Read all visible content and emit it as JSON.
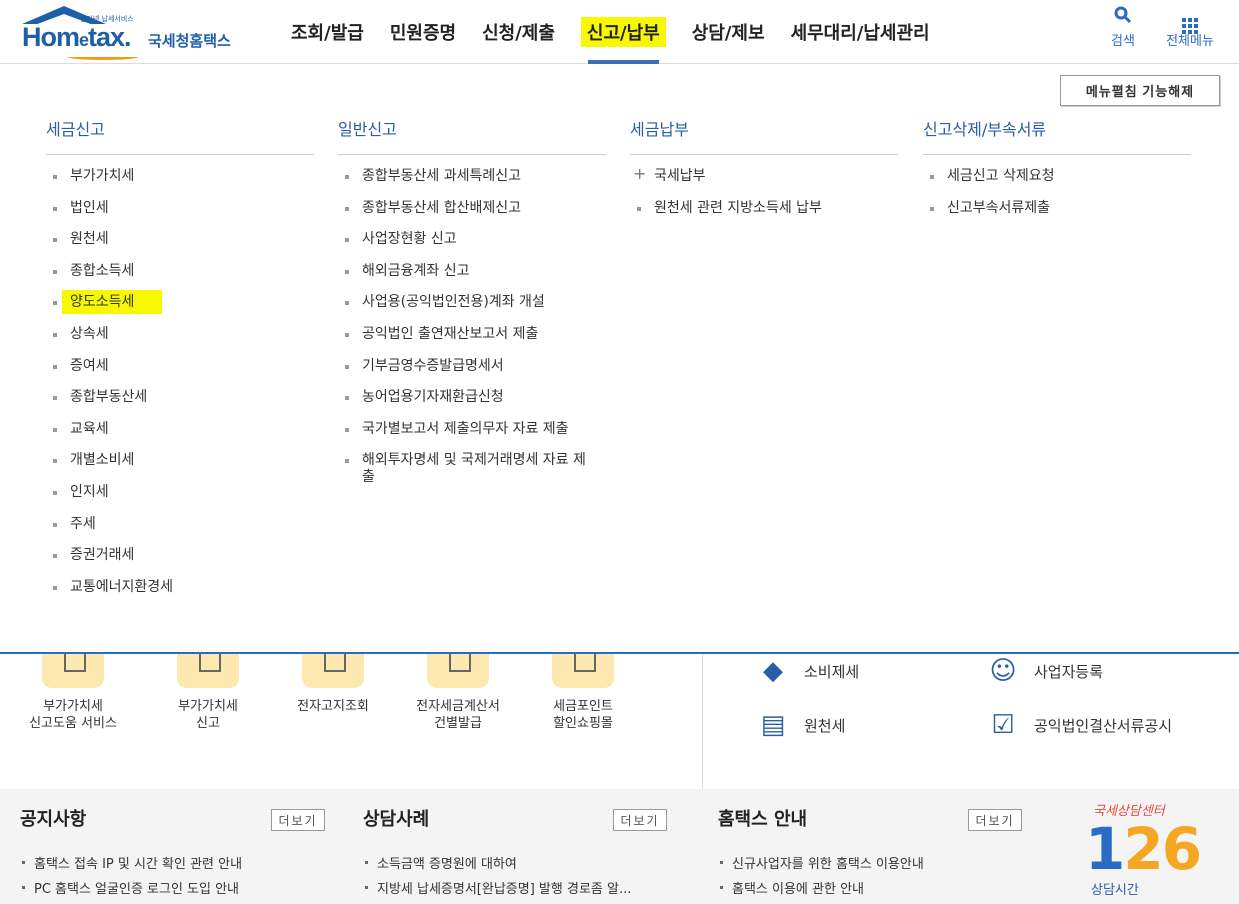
{
  "logo": {
    "tagline": "인터넷 납세서비스",
    "wordmark_home": "Hom",
    "wordmark_e": "e",
    "wordmark_tax": "tax.",
    "korean": "국세청홈택스"
  },
  "gnb": [
    {
      "label": "조회/발급"
    },
    {
      "label": "민원증명"
    },
    {
      "label": "신청/제출"
    },
    {
      "label": "신고/납부",
      "active": true
    },
    {
      "label": "상담/제보"
    },
    {
      "label": "세무대리/납세관리"
    }
  ],
  "util": {
    "search_label": "검색",
    "allmenu_label": "전체메뉴"
  },
  "mega": {
    "fold_button": "메뉴펼침 기능해제",
    "columns": [
      {
        "title": "세금신고",
        "items": [
          "부가가치세",
          "법인세",
          "원천세",
          "종합소득세",
          "양도소득세",
          "상속세",
          "증여세",
          "종합부동산세",
          "교육세",
          "개별소비세",
          "인지세",
          "주세",
          "증권거래세",
          "교통에너지환경세"
        ]
      },
      {
        "title": "일반신고",
        "items": [
          "종합부동산세 과세특례신고",
          "종합부동산세 합산배제신고",
          "사업장현황 신고",
          "해외금융계좌 신고",
          "사업용(공익법인전용)계좌 개설",
          "공익법인 출연재산보고서 제출",
          "기부금영수증발급명세서",
          "농어업용기자재환급신청",
          "국가별보고서 제출의무자 자료 제출",
          "해외투자명세 및 국제거래명세 자료 제출"
        ]
      },
      {
        "title": "세금납부",
        "items": [
          "국세납부",
          "원천세 관련 지방소득세 납부"
        ]
      },
      {
        "title": "신고삭제/부속서류",
        "items": [
          "세금신고 삭제요청",
          "신고부속서류제출"
        ]
      }
    ]
  },
  "quick": [
    {
      "line1": "부가가치세",
      "line2": "신고도움 서비스"
    },
    {
      "line1": "부가가치세",
      "line2": "신고"
    },
    {
      "line1": "전자고지조회",
      "line2": ""
    },
    {
      "line1": "전자세금계산서",
      "line2": "건별발급"
    },
    {
      "line1": "세금포인트",
      "line2": "할인쇼핑몰"
    }
  ],
  "right_links": [
    "소비제세",
    "사업자등록",
    "원천세",
    "공익법인결산서류공시"
  ],
  "boards": [
    {
      "title": "공지사항",
      "more": "더보기",
      "items": [
        "홈택스 접속 IP 및 시간 확인 관련 안내",
        "PC 홈택스 얼굴인증 로그인 도입 안내"
      ]
    },
    {
      "title": "상담사례",
      "more": "더보기",
      "items": [
        "소득금액 증명원에 대하여",
        "지방세 납세증명서[완납증명] 발행 경로좀 알..."
      ]
    },
    {
      "title": "홈택스 안내",
      "more": "더보기",
      "items": [
        "신규사업자를 위한 홈택스 이용안내",
        "홈택스 이용에 관한 안내"
      ]
    }
  ],
  "callcenter": {
    "title": "국세상담센터",
    "number_1": "1",
    "number_rest": "26",
    "hours": "상담시간"
  }
}
